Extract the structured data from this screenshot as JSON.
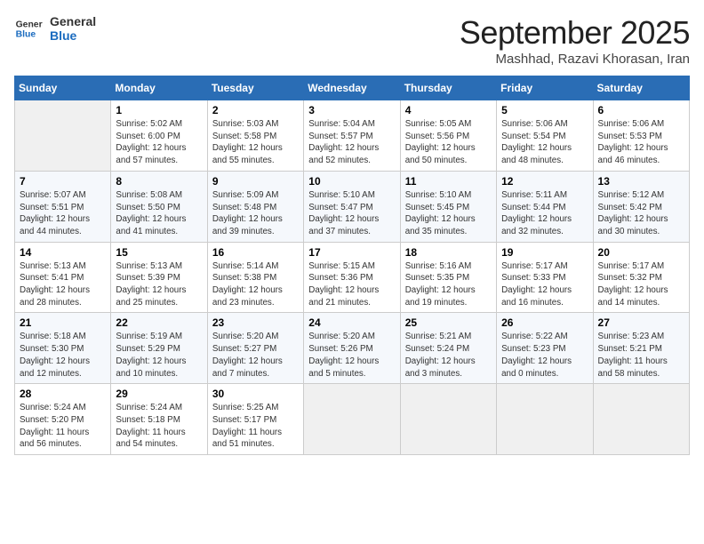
{
  "header": {
    "logo_line1": "General",
    "logo_line2": "Blue",
    "month": "September 2025",
    "location": "Mashhad, Razavi Khorasan, Iran"
  },
  "weekdays": [
    "Sunday",
    "Monday",
    "Tuesday",
    "Wednesday",
    "Thursday",
    "Friday",
    "Saturday"
  ],
  "weeks": [
    [
      {
        "day": "",
        "info": ""
      },
      {
        "day": "1",
        "info": "Sunrise: 5:02 AM\nSunset: 6:00 PM\nDaylight: 12 hours\nand 57 minutes."
      },
      {
        "day": "2",
        "info": "Sunrise: 5:03 AM\nSunset: 5:58 PM\nDaylight: 12 hours\nand 55 minutes."
      },
      {
        "day": "3",
        "info": "Sunrise: 5:04 AM\nSunset: 5:57 PM\nDaylight: 12 hours\nand 52 minutes."
      },
      {
        "day": "4",
        "info": "Sunrise: 5:05 AM\nSunset: 5:56 PM\nDaylight: 12 hours\nand 50 minutes."
      },
      {
        "day": "5",
        "info": "Sunrise: 5:06 AM\nSunset: 5:54 PM\nDaylight: 12 hours\nand 48 minutes."
      },
      {
        "day": "6",
        "info": "Sunrise: 5:06 AM\nSunset: 5:53 PM\nDaylight: 12 hours\nand 46 minutes."
      }
    ],
    [
      {
        "day": "7",
        "info": "Sunrise: 5:07 AM\nSunset: 5:51 PM\nDaylight: 12 hours\nand 44 minutes."
      },
      {
        "day": "8",
        "info": "Sunrise: 5:08 AM\nSunset: 5:50 PM\nDaylight: 12 hours\nand 41 minutes."
      },
      {
        "day": "9",
        "info": "Sunrise: 5:09 AM\nSunset: 5:48 PM\nDaylight: 12 hours\nand 39 minutes."
      },
      {
        "day": "10",
        "info": "Sunrise: 5:10 AM\nSunset: 5:47 PM\nDaylight: 12 hours\nand 37 minutes."
      },
      {
        "day": "11",
        "info": "Sunrise: 5:10 AM\nSunset: 5:45 PM\nDaylight: 12 hours\nand 35 minutes."
      },
      {
        "day": "12",
        "info": "Sunrise: 5:11 AM\nSunset: 5:44 PM\nDaylight: 12 hours\nand 32 minutes."
      },
      {
        "day": "13",
        "info": "Sunrise: 5:12 AM\nSunset: 5:42 PM\nDaylight: 12 hours\nand 30 minutes."
      }
    ],
    [
      {
        "day": "14",
        "info": "Sunrise: 5:13 AM\nSunset: 5:41 PM\nDaylight: 12 hours\nand 28 minutes."
      },
      {
        "day": "15",
        "info": "Sunrise: 5:13 AM\nSunset: 5:39 PM\nDaylight: 12 hours\nand 25 minutes."
      },
      {
        "day": "16",
        "info": "Sunrise: 5:14 AM\nSunset: 5:38 PM\nDaylight: 12 hours\nand 23 minutes."
      },
      {
        "day": "17",
        "info": "Sunrise: 5:15 AM\nSunset: 5:36 PM\nDaylight: 12 hours\nand 21 minutes."
      },
      {
        "day": "18",
        "info": "Sunrise: 5:16 AM\nSunset: 5:35 PM\nDaylight: 12 hours\nand 19 minutes."
      },
      {
        "day": "19",
        "info": "Sunrise: 5:17 AM\nSunset: 5:33 PM\nDaylight: 12 hours\nand 16 minutes."
      },
      {
        "day": "20",
        "info": "Sunrise: 5:17 AM\nSunset: 5:32 PM\nDaylight: 12 hours\nand 14 minutes."
      }
    ],
    [
      {
        "day": "21",
        "info": "Sunrise: 5:18 AM\nSunset: 5:30 PM\nDaylight: 12 hours\nand 12 minutes."
      },
      {
        "day": "22",
        "info": "Sunrise: 5:19 AM\nSunset: 5:29 PM\nDaylight: 12 hours\nand 10 minutes."
      },
      {
        "day": "23",
        "info": "Sunrise: 5:20 AM\nSunset: 5:27 PM\nDaylight: 12 hours\nand 7 minutes."
      },
      {
        "day": "24",
        "info": "Sunrise: 5:20 AM\nSunset: 5:26 PM\nDaylight: 12 hours\nand 5 minutes."
      },
      {
        "day": "25",
        "info": "Sunrise: 5:21 AM\nSunset: 5:24 PM\nDaylight: 12 hours\nand 3 minutes."
      },
      {
        "day": "26",
        "info": "Sunrise: 5:22 AM\nSunset: 5:23 PM\nDaylight: 12 hours\nand 0 minutes."
      },
      {
        "day": "27",
        "info": "Sunrise: 5:23 AM\nSunset: 5:21 PM\nDaylight: 11 hours\nand 58 minutes."
      }
    ],
    [
      {
        "day": "28",
        "info": "Sunrise: 5:24 AM\nSunset: 5:20 PM\nDaylight: 11 hours\nand 56 minutes."
      },
      {
        "day": "29",
        "info": "Sunrise: 5:24 AM\nSunset: 5:18 PM\nDaylight: 11 hours\nand 54 minutes."
      },
      {
        "day": "30",
        "info": "Sunrise: 5:25 AM\nSunset: 5:17 PM\nDaylight: 11 hours\nand 51 minutes."
      },
      {
        "day": "",
        "info": ""
      },
      {
        "day": "",
        "info": ""
      },
      {
        "day": "",
        "info": ""
      },
      {
        "day": "",
        "info": ""
      }
    ]
  ]
}
